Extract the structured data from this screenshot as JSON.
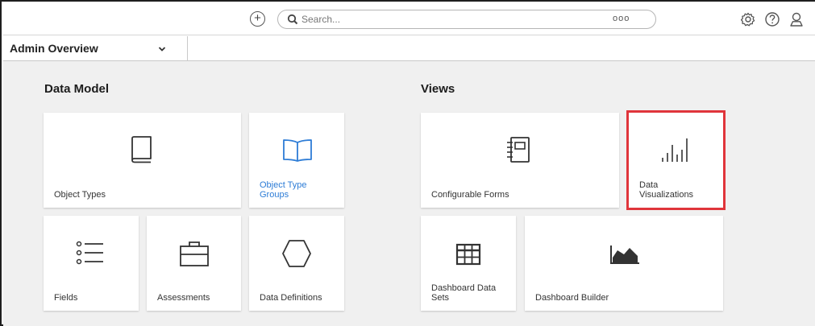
{
  "header": {
    "search_placeholder": "Search...",
    "search_more": "ooo"
  },
  "nav": {
    "selected_view": "Admin Overview"
  },
  "sections": {
    "data_model": {
      "title": "Data Model",
      "tiles": {
        "object_types": "Object Types",
        "object_type_groups_line1": "Object Type",
        "object_type_groups_line2": "Groups",
        "fields": "Fields",
        "assessments": "Assessments",
        "data_definitions": "Data Definitions"
      }
    },
    "views": {
      "title": "Views",
      "tiles": {
        "configurable_forms": "Configurable Forms",
        "data_visualizations_line1": "Data",
        "data_visualizations_line2": "Visualizations",
        "dashboard_data_sets_line1": "Dashboard Data",
        "dashboard_data_sets_line2": "Sets",
        "dashboard_builder": "Dashboard Builder"
      }
    }
  },
  "colors": {
    "highlight": "#e0353b",
    "link_blue": "#2d7cd6",
    "content_bg": "#f0f0f0"
  }
}
